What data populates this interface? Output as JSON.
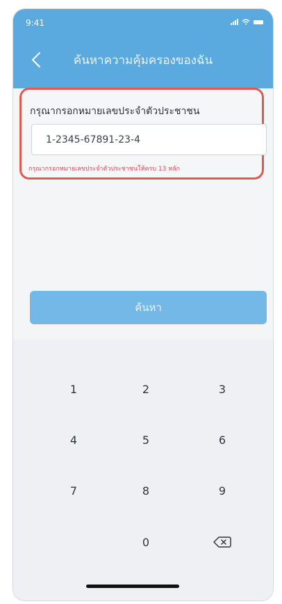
{
  "status_bar": {
    "time": "9:41"
  },
  "header": {
    "title": "ค้นหาความคุ้มครองของฉัน"
  },
  "form": {
    "label": "กรุณากรอกหมายเลขประจำตัวประชาชน",
    "input_value": "1-2345-67891-23-4",
    "error": "กรุณากรอกหมายเลขประจำตัวประชาชนให้ครบ 13 หลัก"
  },
  "button": {
    "label": "ค้นหา"
  },
  "keypad": {
    "keys": [
      "1",
      "2",
      "3",
      "4",
      "5",
      "6",
      "7",
      "8",
      "9",
      "",
      "0",
      ""
    ]
  },
  "colors": {
    "header": "#5aaae0",
    "button": "#74b8e8",
    "error": "#e0454f",
    "highlight_border": "#e05a4f"
  },
  "icons": {
    "back": "chevron-left-icon",
    "delete": "backspace-icon"
  }
}
